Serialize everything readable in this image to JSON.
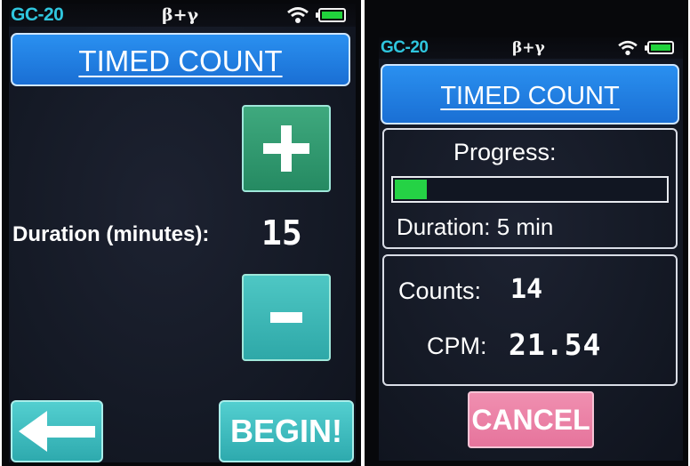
{
  "left_screen": {
    "status": {
      "model": "GC-20",
      "mode": "β+γ"
    },
    "title": "TIMED COUNT",
    "plus_label": "+",
    "duration_label": "Duration (minutes):",
    "duration_value": "15",
    "minus_label": "-",
    "back_label": "←",
    "begin_label": "BEGIN!"
  },
  "right_screen": {
    "status": {
      "model": "GC-20",
      "mode": "β+γ"
    },
    "title": "TIMED COUNT",
    "progress_label": "Progress:",
    "progress_fraction": 0.13,
    "duration_text": "Duration: 5 min",
    "counts_label": "Counts:",
    "counts_value": "14",
    "cpm_label": "CPM:",
    "cpm_value": "21.54",
    "cancel_label": "CANCEL"
  },
  "colors": {
    "accent_blue": "#1f7fe0",
    "model_cyan": "#2fc6de",
    "progress_green": "#25d245",
    "battery_green": "#21d33c",
    "button_teal": "#3bbab9",
    "cancel_pink": "#ea7fa5"
  },
  "icons": [
    "wifi-icon",
    "battery-icon",
    "plus-icon",
    "minus-icon",
    "back-arrow-icon"
  ]
}
